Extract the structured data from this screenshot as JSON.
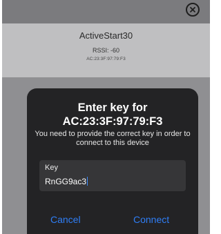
{
  "device": {
    "name": "ActiveStart30",
    "rssi": "RSSI: -60",
    "mac": "AC:23:3F:97:79:F3"
  },
  "dialog": {
    "title": "Enter key for AC:23:3F:97:79:F3",
    "message": "You need to provide the correct key in order to connect to this device",
    "key_label": "Key",
    "key_value": "RnGG9ac3",
    "cancel_label": "Cancel",
    "connect_label": "Connect"
  },
  "icons": {
    "close": "close-icon"
  },
  "colors": {
    "accent": "#2f7ef6",
    "dialog_bg": "#232325",
    "overlay": "#8f8f92"
  }
}
